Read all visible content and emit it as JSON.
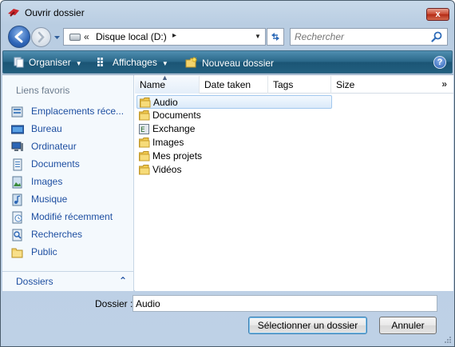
{
  "window": {
    "title": "Ouvrir dossier",
    "close_glyph": "x"
  },
  "nav": {
    "address_prefix": "«",
    "address_path": "Disque local (D:)",
    "address_arrow": "▸",
    "search_placeholder": "Rechercher"
  },
  "toolbar": {
    "organize": "Organiser",
    "views": "Affichages",
    "new_folder": "Nouveau dossier",
    "help_glyph": "?"
  },
  "sidebar": {
    "title": "Liens favoris",
    "items": [
      {
        "label": "Emplacements réce...",
        "icon": "recent-places-icon"
      },
      {
        "label": "Bureau",
        "icon": "desktop-icon"
      },
      {
        "label": "Ordinateur",
        "icon": "computer-icon"
      },
      {
        "label": "Documents",
        "icon": "documents-icon"
      },
      {
        "label": "Images",
        "icon": "pictures-icon"
      },
      {
        "label": "Musique",
        "icon": "music-icon"
      },
      {
        "label": "Modifié récemment",
        "icon": "recently-changed-icon"
      },
      {
        "label": "Recherches",
        "icon": "searches-icon"
      },
      {
        "label": "Public",
        "icon": "public-folder-icon"
      }
    ],
    "folders_label": "Dossiers",
    "folders_chevron": "⌃"
  },
  "columns": [
    "Name",
    "Date taken",
    "Tags",
    "Size"
  ],
  "columns_more": "»",
  "files": [
    {
      "name": "Audio",
      "icon": "folder-icon",
      "selected": true
    },
    {
      "name": "Documents",
      "icon": "folder-icon",
      "selected": false
    },
    {
      "name": "Exchange",
      "icon": "exchange-folder-icon",
      "selected": false
    },
    {
      "name": "Images",
      "icon": "folder-icon",
      "selected": false
    },
    {
      "name": "Mes projets",
      "icon": "folder-icon",
      "selected": false
    },
    {
      "name": "Vidéos",
      "icon": "folder-icon",
      "selected": false
    }
  ],
  "footer": {
    "folder_label": "Dossier :",
    "folder_value": "Audio",
    "select_button": "Sélectionner un dossier",
    "cancel_button": "Annuler"
  }
}
